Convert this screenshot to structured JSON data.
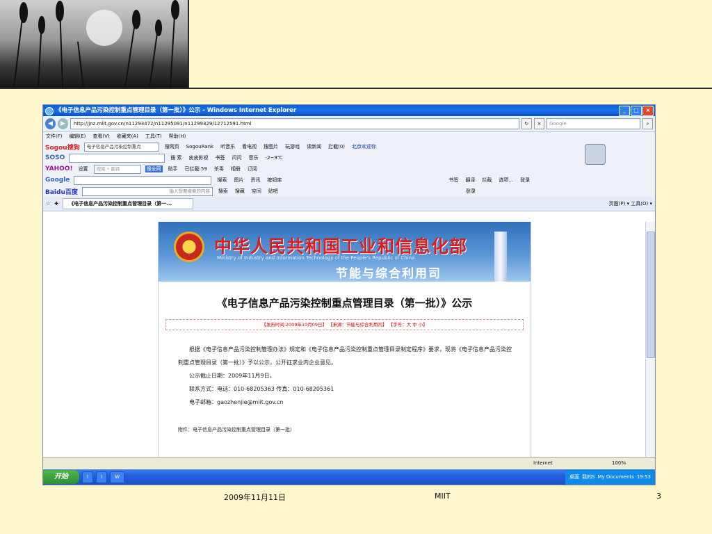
{
  "slide": {
    "footer_date": "2009年11月11日",
    "footer_center": "MIIT",
    "page_number": "3",
    "background_color": "#FFF6CC"
  },
  "browser": {
    "window_title": "《电子信息产品污染控制重点管理目录（第一批）》公示 - Windows Internet Explorer",
    "address": "http://jnz.miit.gov.cn/n11293472/n11295091/n11299329/12712591.html",
    "search_placeholder": "Google",
    "menu": [
      "文件(F)",
      "编辑(E)",
      "查看(V)",
      "收藏夹(A)",
      "工具(T)",
      "帮助(H)"
    ],
    "toolbars": [
      {
        "brand": "Sogou搜狗",
        "input": "电子信息产品污染控制重点",
        "items": [
          "搜网页",
          "SogouRank",
          "听音乐",
          "看电视",
          "搜图片",
          "玩游戏",
          "读新闻",
          "拦截(0)",
          "北京欢迎你"
        ]
      },
      {
        "brand": "SOSO",
        "input": "",
        "items": [
          "搜 索",
          "皮皮影视",
          "书签",
          "问问",
          "音乐",
          "-2~9℃"
        ]
      },
      {
        "brand": "YAHOO!",
        "input": "搜索 • 翻译",
        "items": [
          "设置",
          "搜全网",
          "助手",
          "已拦截:59",
          "杀毒",
          "相册",
          "订阅"
        ]
      },
      {
        "brand": "Google",
        "input": "",
        "items": [
          "搜索",
          "图片",
          "资讯",
          "按钮库",
          "书签",
          "翻译",
          "拦截",
          "选项...",
          "登录"
        ]
      },
      {
        "brand": "Baidu百度",
        "input": "输入想要搜索的内容",
        "items": [
          "搜索",
          "搜藏",
          "空间",
          "贴吧",
          "登录"
        ]
      }
    ],
    "tab_label": "《电子信息产品污染控制重点管理目录（第一...",
    "tab_tools": "页面(P) ▾ 工具(O) ▾",
    "status_zone": "Internet",
    "status_zoom": "100%"
  },
  "webpage": {
    "banner_title": "中华人民共和国工业和信息化部",
    "banner_en": "Ministry of Industry and Information Technology of the People's Republic of China",
    "banner_sub": "节能与综合利用司",
    "doc_title": "《电子信息产品污染控制重点管理目录（第一批）》公示",
    "meta": "【发布时间:2009年10月09日】 【来源：节能与综合利用司】 【字号：大 中 小】",
    "para1": "根据《电子信息产品污染控制管理办法》规定和《电子信息产品污染控制重点管理目录制定程序》要求，现将《电子信息产品污染控制重点管理目录（第一批）》予以公示，公开征求业内企业意见。",
    "deadline": "公示截止日期：2009年11月9日。",
    "contact": "联系方式：电话：010-68205363  传真：010-68205361",
    "email": "电子邮箱：gaozhenjie@miit.gov.cn",
    "attachment": "附件：电子信息产品污染控制重点管理目录（第一批）"
  },
  "taskbar": {
    "start_label": "开始",
    "tasks": [
      "I",
      "I",
      "W"
    ],
    "tray_items": [
      "桌面",
      "我的S",
      "My Documents"
    ],
    "clock": "19:53"
  }
}
